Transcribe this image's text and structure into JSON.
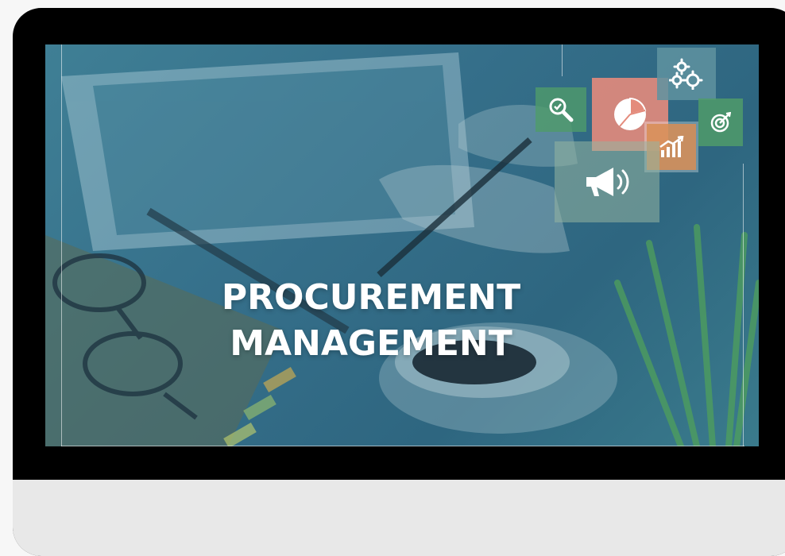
{
  "title": {
    "line1": "PROCUREMENT",
    "line2": "MANAGEMENT"
  },
  "icons": [
    "magnifier-check-icon",
    "pie-chart-icon",
    "gears-icon",
    "growth-chart-icon",
    "target-icon",
    "megaphone-icon"
  ],
  "colors": {
    "bezel": "#000000",
    "overlay": "#3a7890",
    "tile_green": "#4f9b6a",
    "tile_salmon": "#e48b7c",
    "tile_orange": "#d9925c",
    "tile_teal": "#5f93a0"
  }
}
